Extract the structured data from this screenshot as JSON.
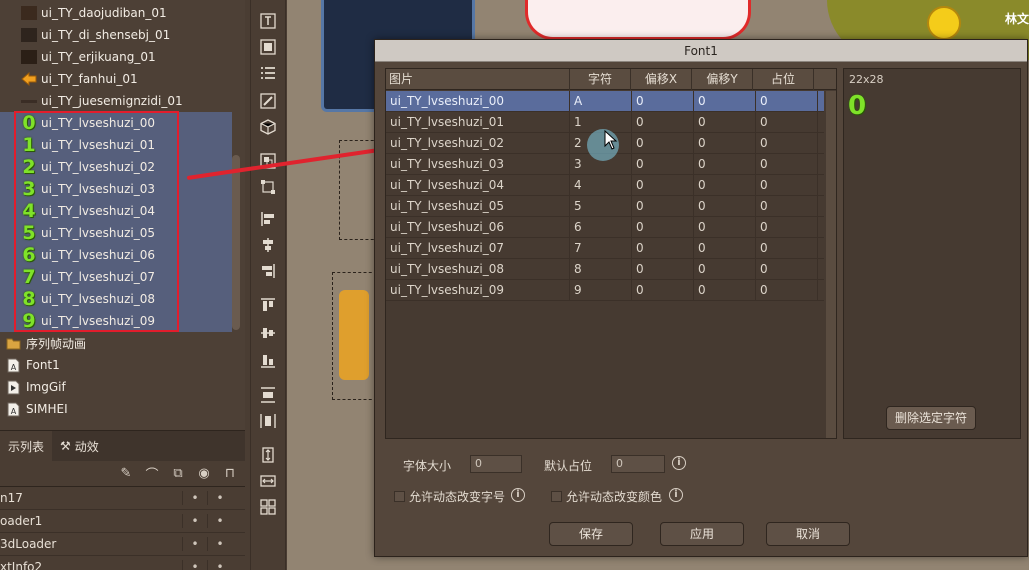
{
  "resources": {
    "top_items": [
      {
        "label": "ui_TY_daojudiban_01",
        "swatch": "#3b2a1e"
      },
      {
        "label": "ui_TY_di_shensebj_01",
        "swatch": "#2e241d"
      },
      {
        "label": "ui_TY_erjikuang_01",
        "swatch": "#2b1f16"
      },
      {
        "label": "ui_TY_fanhui_01",
        "swatch": "#e09420"
      },
      {
        "label": "ui_TY_juesemignzidi_01",
        "swatch": "#3a2d25"
      }
    ],
    "digit_items": [
      {
        "glyph": "0",
        "label": "ui_TY_lvseshuzi_00"
      },
      {
        "glyph": "1",
        "label": "ui_TY_lvseshuzi_01"
      },
      {
        "glyph": "2",
        "label": "ui_TY_lvseshuzi_02"
      },
      {
        "glyph": "3",
        "label": "ui_TY_lvseshuzi_03"
      },
      {
        "glyph": "4",
        "label": "ui_TY_lvseshuzi_04"
      },
      {
        "glyph": "5",
        "label": "ui_TY_lvseshuzi_05"
      },
      {
        "glyph": "6",
        "label": "ui_TY_lvseshuzi_06"
      },
      {
        "glyph": "7",
        "label": "ui_TY_lvseshuzi_07"
      },
      {
        "glyph": "8",
        "label": "ui_TY_lvseshuzi_08"
      },
      {
        "glyph": "9",
        "label": "ui_TY_lvseshuzi_09"
      }
    ],
    "other_items": [
      {
        "label": "序列帧动画",
        "icon": "folder-icon"
      },
      {
        "label": "Font1",
        "icon": "font-file-icon"
      },
      {
        "label": "ImgGif",
        "icon": "gif-file-icon"
      },
      {
        "label": "SIMHEI",
        "icon": "font-file-icon"
      }
    ]
  },
  "layer_panel": {
    "tabs": [
      "示列表",
      "动效"
    ],
    "rows": [
      {
        "name": "n17",
        "c1": "•",
        "c2": "•"
      },
      {
        "name": "oader1",
        "c1": "•",
        "c2": "•"
      },
      {
        "name": "3dLoader",
        "c1": "•",
        "c2": "•"
      },
      {
        "name": "xtInfo2",
        "c1": "•",
        "c2": "•"
      }
    ]
  },
  "canvas": {
    "corner_text": "林文",
    "colors": {
      "selection_red": "#e21d2c",
      "digit_green": "#7fe229"
    }
  },
  "dialog": {
    "title": "Font1",
    "columns": [
      "图片",
      "字符",
      "偏移X",
      "偏移Y",
      "占位"
    ],
    "rows": [
      {
        "image": "ui_TY_lvseshuzi_00",
        "char": "A",
        "ox": "0",
        "oy": "0",
        "adv": "0"
      },
      {
        "image": "ui_TY_lvseshuzi_01",
        "char": "1",
        "ox": "0",
        "oy": "0",
        "adv": "0"
      },
      {
        "image": "ui_TY_lvseshuzi_02",
        "char": "2",
        "ox": "0",
        "oy": "0",
        "adv": "0"
      },
      {
        "image": "ui_TY_lvseshuzi_03",
        "char": "3",
        "ox": "0",
        "oy": "0",
        "adv": "0"
      },
      {
        "image": "ui_TY_lvseshuzi_04",
        "char": "4",
        "ox": "0",
        "oy": "0",
        "adv": "0"
      },
      {
        "image": "ui_TY_lvseshuzi_05",
        "char": "5",
        "ox": "0",
        "oy": "0",
        "adv": "0"
      },
      {
        "image": "ui_TY_lvseshuzi_06",
        "char": "6",
        "ox": "0",
        "oy": "0",
        "adv": "0"
      },
      {
        "image": "ui_TY_lvseshuzi_07",
        "char": "7",
        "ox": "0",
        "oy": "0",
        "adv": "0"
      },
      {
        "image": "ui_TY_lvseshuzi_08",
        "char": "8",
        "ox": "0",
        "oy": "0",
        "adv": "0"
      },
      {
        "image": "ui_TY_lvseshuzi_09",
        "char": "9",
        "ox": "0",
        "oy": "0",
        "adv": "0"
      }
    ],
    "selected_row": 0,
    "preview": {
      "size": "22x28",
      "glyph": "0"
    },
    "delete_button": "删除选定字符",
    "font_size_label": "字体大小",
    "font_size_value": "0",
    "default_adv_label": "默认占位",
    "default_adv_value": "0",
    "allow_size_label": "允许动态改变字号",
    "allow_color_label": "允许动态改变颜色",
    "buttons": {
      "save": "保存",
      "apply": "应用",
      "cancel": "取消"
    }
  }
}
